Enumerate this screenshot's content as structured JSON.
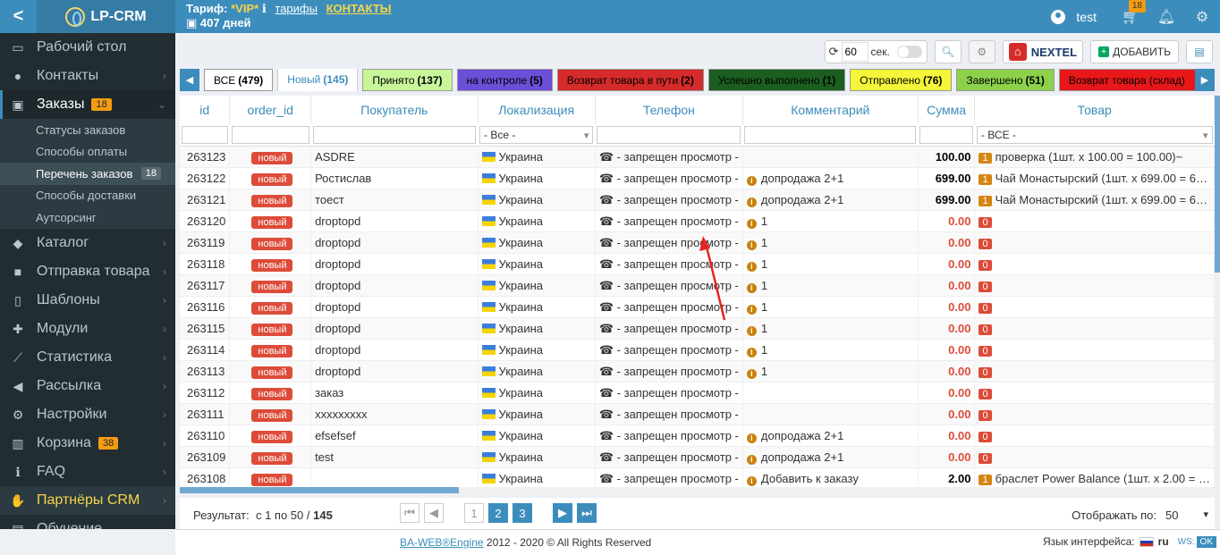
{
  "header": {
    "app_name": "LP-CRM",
    "tarif_label": "Тариф:",
    "tarif_value": "*VIP*",
    "tarifs_link": "тарифы",
    "contacts_link": "КОНТАКТЫ",
    "days": "407 дней",
    "user": "test",
    "cart_count": "18"
  },
  "sidebar": {
    "items": [
      {
        "label": "Рабочий стол",
        "icon": "desktop-icon"
      },
      {
        "label": "Контакты",
        "icon": "users-icon"
      },
      {
        "label": "Заказы",
        "icon": "money-icon",
        "badge": "18"
      },
      {
        "label": "Каталог",
        "icon": "tag-icon"
      },
      {
        "label": "Отправка товара",
        "icon": "truck-icon"
      },
      {
        "label": "Шаблоны",
        "icon": "file-icon"
      },
      {
        "label": "Модули",
        "icon": "puzzle-icon"
      },
      {
        "label": "Статистика",
        "icon": "chart-icon"
      },
      {
        "label": "Рассылка",
        "icon": "bullhorn-icon"
      },
      {
        "label": "Настройки",
        "icon": "gear-icon"
      },
      {
        "label": "Корзина",
        "icon": "trash-icon",
        "badge": "38"
      },
      {
        "label": "FAQ",
        "icon": "info-icon"
      },
      {
        "label": "Партнёры CRM",
        "icon": "handshake-icon"
      },
      {
        "label": "Обучение",
        "icon": "book-icon"
      }
    ],
    "subitems": [
      {
        "label": "Статусы заказов"
      },
      {
        "label": "Способы оплаты"
      },
      {
        "label": "Перечень заказов",
        "badge": "18"
      },
      {
        "label": "Способы доставки"
      },
      {
        "label": "Аутсорсинг"
      }
    ]
  },
  "toolbar": {
    "refresh_value": "60",
    "sec_label": "сек.",
    "nextel_label": "NEXTEL",
    "add_label": "ДОБАВИТЬ"
  },
  "tabs": [
    {
      "label": "ВСЕ",
      "count": "(479)",
      "bg": "#ffffff"
    },
    {
      "label": "Новый",
      "count": "(145)",
      "bg": "#ffffff"
    },
    {
      "label": "Принято",
      "count": "(137)",
      "bg": "#c8f59a"
    },
    {
      "label": "на контроле",
      "count": "(5)",
      "bg": "#6b4fd8"
    },
    {
      "label": "Возврат товара в пути",
      "count": "(2)",
      "bg": "#d62b2b"
    },
    {
      "label": "Успешно выполнено",
      "count": "(1)",
      "bg": "#1b5e20"
    },
    {
      "label": "Отправлено",
      "count": "(76)",
      "bg": "#f5f53a"
    },
    {
      "label": "Завершено",
      "count": "(51)",
      "bg": "#8bd24a"
    },
    {
      "label": "Возврат товара (склад)",
      "count": "",
      "bg": "#e81818"
    }
  ],
  "table": {
    "columns": [
      "id",
      "order_id",
      "Покупатель",
      "Локализация",
      "Телефон",
      "Комментарий",
      "Сумма",
      "Товар"
    ],
    "filter_loc": "- Все -",
    "filter_prod": "- ВСЕ -",
    "status": "новый",
    "country": "Украина",
    "phone": "- запрещен просмотр -",
    "rows": [
      {
        "id": "263123",
        "buyer": "ASDRE",
        "comment": "",
        "sum": "100.00",
        "qty": "1",
        "product": "проверка (1шт. x 100.00 = 100.00)~"
      },
      {
        "id": "263122",
        "buyer": "Ростислав",
        "comment": "допродажа 2+1",
        "sum": "699.00",
        "qty": "1",
        "product": "Чай Монастырский (1шт. x 699.00 = 6…"
      },
      {
        "id": "263121",
        "buyer": "тоест",
        "comment": "допродажа 2+1",
        "sum": "699.00",
        "qty": "1",
        "product": "Чай Монастырский (1шт. x 699.00 = 6…"
      },
      {
        "id": "263120",
        "buyer": "droptopd",
        "comment": "1",
        "sum": "0.00",
        "qty": "0",
        "product": ""
      },
      {
        "id": "263119",
        "buyer": "droptopd",
        "comment": "1",
        "sum": "0.00",
        "qty": "0",
        "product": ""
      },
      {
        "id": "263118",
        "buyer": "droptopd",
        "comment": "1",
        "sum": "0.00",
        "qty": "0",
        "product": ""
      },
      {
        "id": "263117",
        "buyer": "droptopd",
        "comment": "1",
        "sum": "0.00",
        "qty": "0",
        "product": ""
      },
      {
        "id": "263116",
        "buyer": "droptopd",
        "comment": "1",
        "sum": "0.00",
        "qty": "0",
        "product": ""
      },
      {
        "id": "263115",
        "buyer": "droptopd",
        "comment": "1",
        "sum": "0.00",
        "qty": "0",
        "product": ""
      },
      {
        "id": "263114",
        "buyer": "droptopd",
        "comment": "1",
        "sum": "0.00",
        "qty": "0",
        "product": ""
      },
      {
        "id": "263113",
        "buyer": "droptopd",
        "comment": "1",
        "sum": "0.00",
        "qty": "0",
        "product": ""
      },
      {
        "id": "263112",
        "buyer": "заказ",
        "comment": "",
        "sum": "0.00",
        "qty": "0",
        "product": ""
      },
      {
        "id": "263111",
        "buyer": "xxxxxxxxx",
        "comment": "",
        "sum": "0.00",
        "qty": "0",
        "product": ""
      },
      {
        "id": "263110",
        "buyer": "efsefsef",
        "comment": "допродажа 2+1",
        "sum": "0.00",
        "qty": "0",
        "product": ""
      },
      {
        "id": "263109",
        "buyer": "test",
        "comment": "допродажа 2+1",
        "sum": "0.00",
        "qty": "0",
        "product": ""
      },
      {
        "id": "263108",
        "buyer": "",
        "comment": "Добавить к заказу",
        "sum": "2.00",
        "qty": "1",
        "product": "браслет Power Balance (1шт. x 2.00 = …"
      }
    ]
  },
  "footer": {
    "result_label": "Результат:",
    "result_range": "с 1 по 50 /",
    "result_total": "145",
    "pages": [
      "1",
      "2",
      "3"
    ],
    "perpage_label": "Отображать по:",
    "perpage_value": "50"
  },
  "bottom": {
    "brand": "BA-WEB®Engine",
    "copyright": "2012 - 2020 © All Rights Reserved",
    "lang_label": "Язык интерфейса:",
    "lang": "ru",
    "ws": "WS:",
    "ok": "OK"
  }
}
